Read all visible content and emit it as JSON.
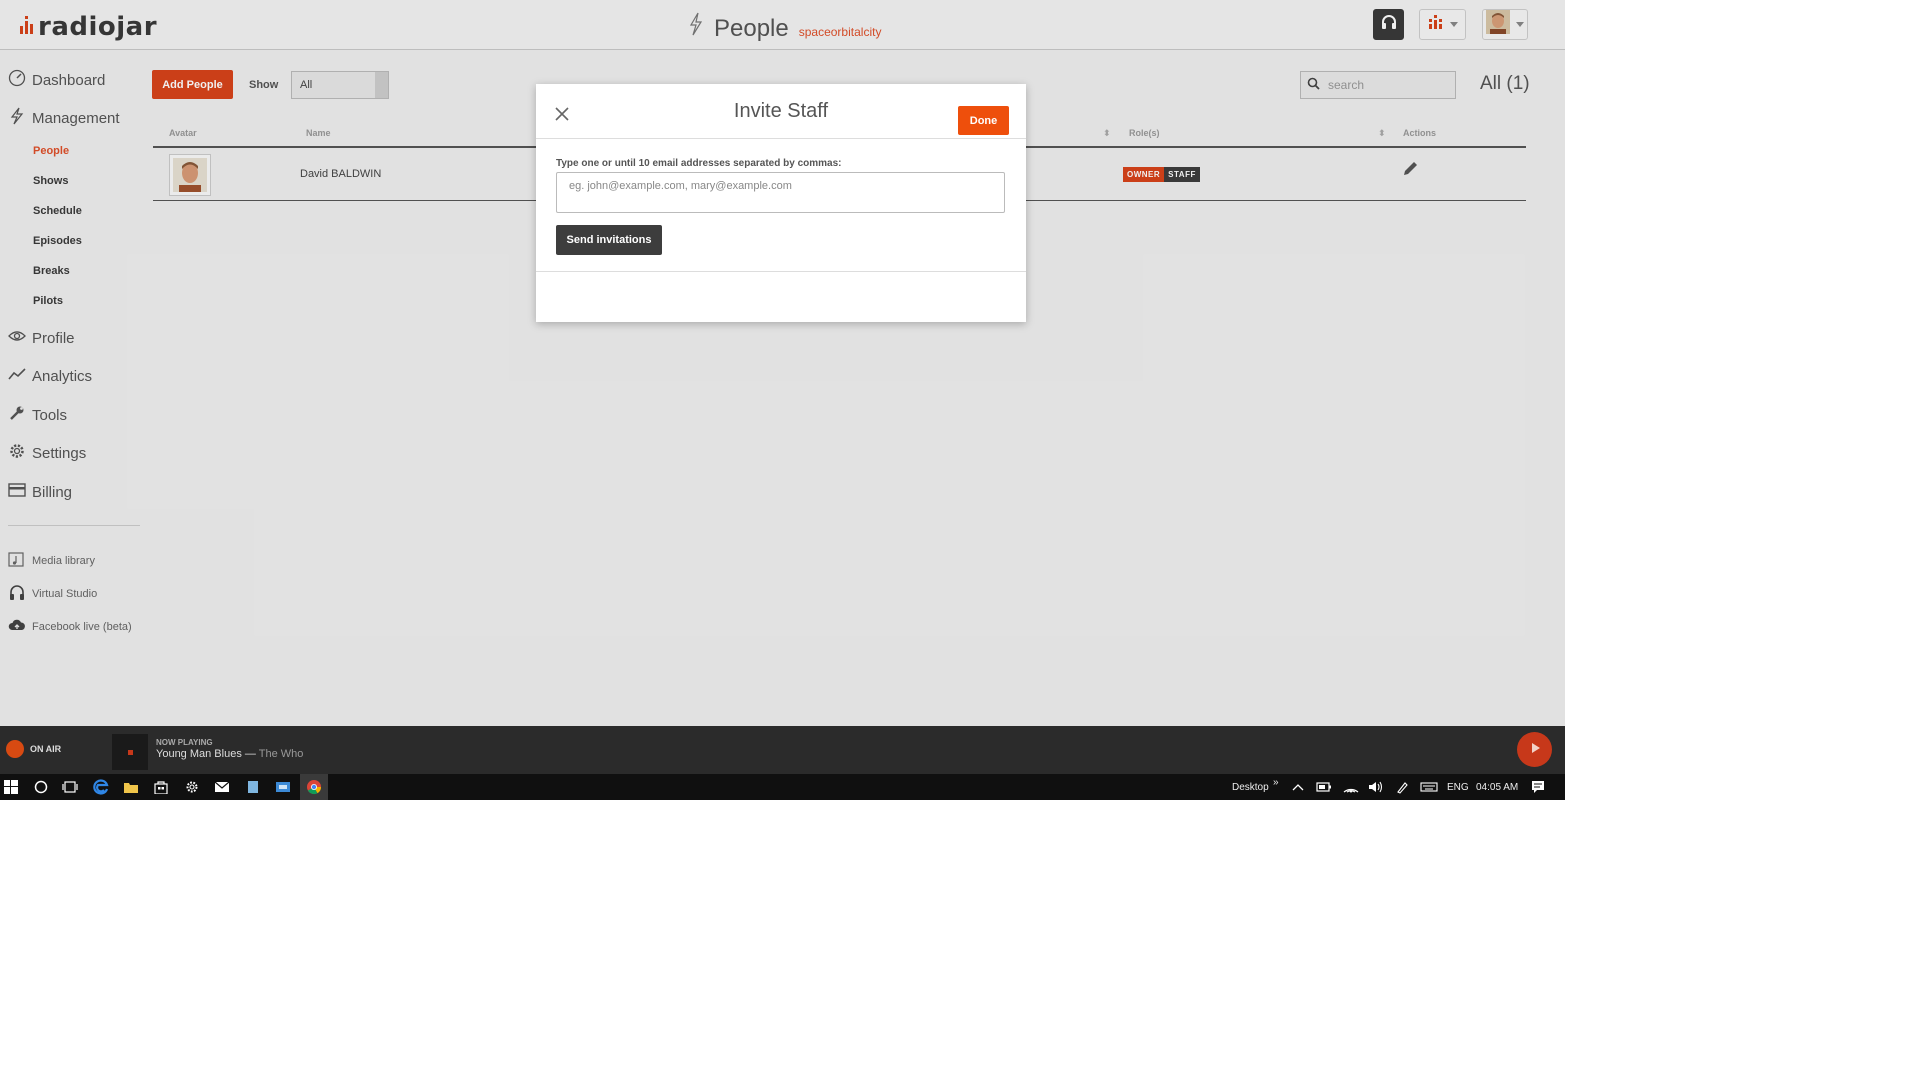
{
  "header": {
    "logo_text": "radiojar",
    "page_title": "People",
    "station_name": "spaceorbitalcity"
  },
  "sidebar": {
    "main_items": [
      {
        "label": "Dashboard",
        "icon": "dashboard-icon"
      },
      {
        "label": "Management",
        "icon": "lightning-icon"
      },
      {
        "label": "Profile",
        "icon": "eye-icon"
      },
      {
        "label": "Analytics",
        "icon": "chart-line-icon"
      },
      {
        "label": "Tools",
        "icon": "wrench-icon"
      },
      {
        "label": "Settings",
        "icon": "gear-icon"
      },
      {
        "label": "Billing",
        "icon": "credit-card-icon"
      }
    ],
    "sub_items": [
      "People",
      "Shows",
      "Schedule",
      "Episodes",
      "Breaks",
      "Pilots"
    ],
    "extra_items": [
      {
        "label": "Media library",
        "icon": "media-library-icon"
      },
      {
        "label": "Virtual Studio",
        "icon": "headphones-icon"
      },
      {
        "label": "Facebook live (beta)",
        "icon": "cloud-upload-icon"
      }
    ]
  },
  "toolbar": {
    "add_button": "Add People",
    "show_label": "Show",
    "show_selected": "All",
    "search_placeholder": "search",
    "count_label": "All (1)"
  },
  "table": {
    "columns": [
      "Avatar",
      "Name",
      "Role(s)",
      "Actions"
    ],
    "rows": [
      {
        "name": "David BALDWIN",
        "roles": [
          "OWNER",
          "STAFF"
        ]
      }
    ]
  },
  "modal": {
    "title": "Invite Staff",
    "done_label": "Done",
    "field_label": "Type one or until 10 email addresses separated by commas:",
    "field_placeholder": "eg. john@example.com, mary@example.com",
    "field_value": "",
    "send_label": "Send invitations"
  },
  "player": {
    "on_air_label": "ON AIR",
    "now_playing_label": "NOW PLAYING",
    "track_title": "Young Man Blues",
    "separator": " — ",
    "track_artist": "The Who"
  },
  "taskbar": {
    "desktop_label": "Desktop",
    "language": "ENG",
    "time": "04:05 AM"
  },
  "colors": {
    "accent": "#e0502a",
    "done_button": "#ee4f0c",
    "owner_badge": "#d8431a",
    "staff_badge": "#3d3d3d",
    "player_bg": "#2b2b2b"
  }
}
